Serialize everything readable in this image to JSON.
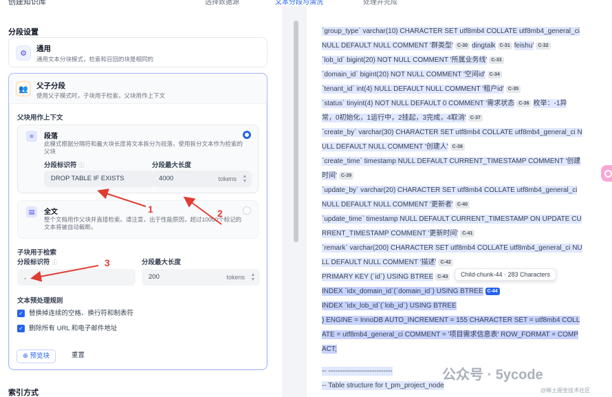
{
  "top": {
    "title": "创建知识库",
    "steps": [
      "选择数据源",
      "文本分段与清洗",
      "处理并完成"
    ]
  },
  "left": {
    "section_title": "分段设置",
    "general": {
      "title": "通用",
      "desc": "通用文本分块模式，检索和召回的块是相同的"
    },
    "parent_child": {
      "title": "父子分段",
      "desc": "使用父子模式时，子块用于检索，父块用作上下文",
      "parent_context_label": "父块用作上下文",
      "paragraph": {
        "title": "段落",
        "desc": "此模式根据分隔符和最大块长度将文本拆分为段落，使用拆分文本作为检索的父块",
        "delimiter_label": "分段标识符",
        "delimiter_value": "DROP TABLE IF EXISTS",
        "maxlen_label": "分段最大长度",
        "maxlen_value": "4000",
        "unit": "tokens"
      },
      "fulltext": {
        "title": "全文",
        "desc": "整个文档用作父块并直接检索。请注意，出于性能原因，超过10000个标记的文本将被自动截断。"
      },
      "child_label": "子块用于检索",
      "child": {
        "delimiter_label": "分段标识符",
        "delimiter_value": ",",
        "maxlen_label": "分段最大长度",
        "maxlen_value": "200",
        "unit": "tokens"
      },
      "preprocess_label": "文本预处理规则",
      "rules": [
        "替换掉连续的空格、换行符和制表符",
        "删除所有 URL 和电子邮件地址"
      ],
      "preview_button": "预览块",
      "reset_button": "重置"
    },
    "index_title": "索引方式",
    "annotations": [
      "1",
      "2",
      "3"
    ]
  },
  "right": {
    "lines": [
      {
        "text": "`group_type` varchar(10) CHARACTER SET utf8mb4 COLLATE utf8mb4_general_ci",
        "chips": []
      },
      {
        "text": "NULL DEFAULT NULL COMMENT '群类型'",
        "chips": [
          "C-30"
        ],
        "after": "dingtalk",
        "chips2": [
          "C-31"
        ],
        "after2": "feishu'",
        "chips3": [
          "C-32"
        ]
      },
      {
        "text": "`lob_id` bigint(20) NOT NULL COMMENT '所属业务线'",
        "chips": [
          "C-33"
        ]
      },
      {
        "text": "`domain_id` bigint(20) NOT NULL COMMENT '空间id'",
        "chips": [
          "C-34"
        ]
      },
      {
        "text": "`tenant_id` int(4) NULL DEFAULT NULL COMMENT '租户id'",
        "chips": [
          "C-35"
        ]
      },
      {
        "text": "`status` tinyint(4) NOT NULL DEFAULT 0 COMMENT '需求状态",
        "chips": [
          "C-36"
        ],
        "after": "枚举：-1异"
      },
      {
        "text": "常，0初始化，1运行中，2挂起，3完成，4取消'",
        "chips": [
          "C-37"
        ]
      },
      {
        "text": "`create_by` varchar(30) CHARACTER SET utf8mb4 COLLATE utf8mb4_general_ci N",
        "chips": []
      },
      {
        "text": "ULL DEFAULT NULL COMMENT '创建人'",
        "chips": [
          "C-38"
        ]
      },
      {
        "text": "`create_time` timestamp NULL DEFAULT CURRENT_TIMESTAMP COMMENT '创建",
        "chips": []
      },
      {
        "text": "时间'",
        "chips": [
          "C-39"
        ]
      },
      {
        "text": "`update_by` varchar(20) CHARACTER SET utf8mb4 COLLATE utf8mb4_general_ci",
        "chips": []
      },
      {
        "text": "NULL DEFAULT NULL COMMENT '更新者'",
        "chips": [
          "C-40"
        ]
      },
      {
        "text": "`update_time` timestamp NULL DEFAULT CURRENT_TIMESTAMP ON UPDATE CU",
        "chips": []
      },
      {
        "text": "RRENT_TIMESTAMP COMMENT '更新时间'",
        "chips": [
          "C-41"
        ]
      },
      {
        "text": "`remark` varchar(200) CHARACTER SET utf8mb4 COLLATE utf8mb4_general_ci NU",
        "chips": []
      },
      {
        "text": "LL DEFAULT NULL COMMENT '描述'",
        "chips": [
          "C-42"
        ]
      },
      {
        "text": "PRIMARY KEY (`id`) USING BTREE",
        "chips": [
          "C-43"
        ]
      }
    ],
    "tooltip": "Child-chunk-44 · 283 Characters",
    "chunk44": [
      "INDEX `idx_domain_id`(`domain_id`) USING BTREE",
      "INDEX `idx_lob_id`(`lob_id`) USING BTREE",
      ") ENGINE = InnoDB AUTO_INCREMENT = 155 CHARACTER SET = utf8mb4 COLL",
      "ATE = utf8mb4_general_ci COMMENT = '项目需求信息表' ROW_FORMAT = COMP",
      "ACT;"
    ],
    "chip44": "C-44",
    "next": [
      "-- ----------------------------",
      "-- Table structure for t_pm_project_node"
    ],
    "watermark": "公众号 · 5ycode",
    "watermark_small": "@稀土掘金技术社区"
  }
}
